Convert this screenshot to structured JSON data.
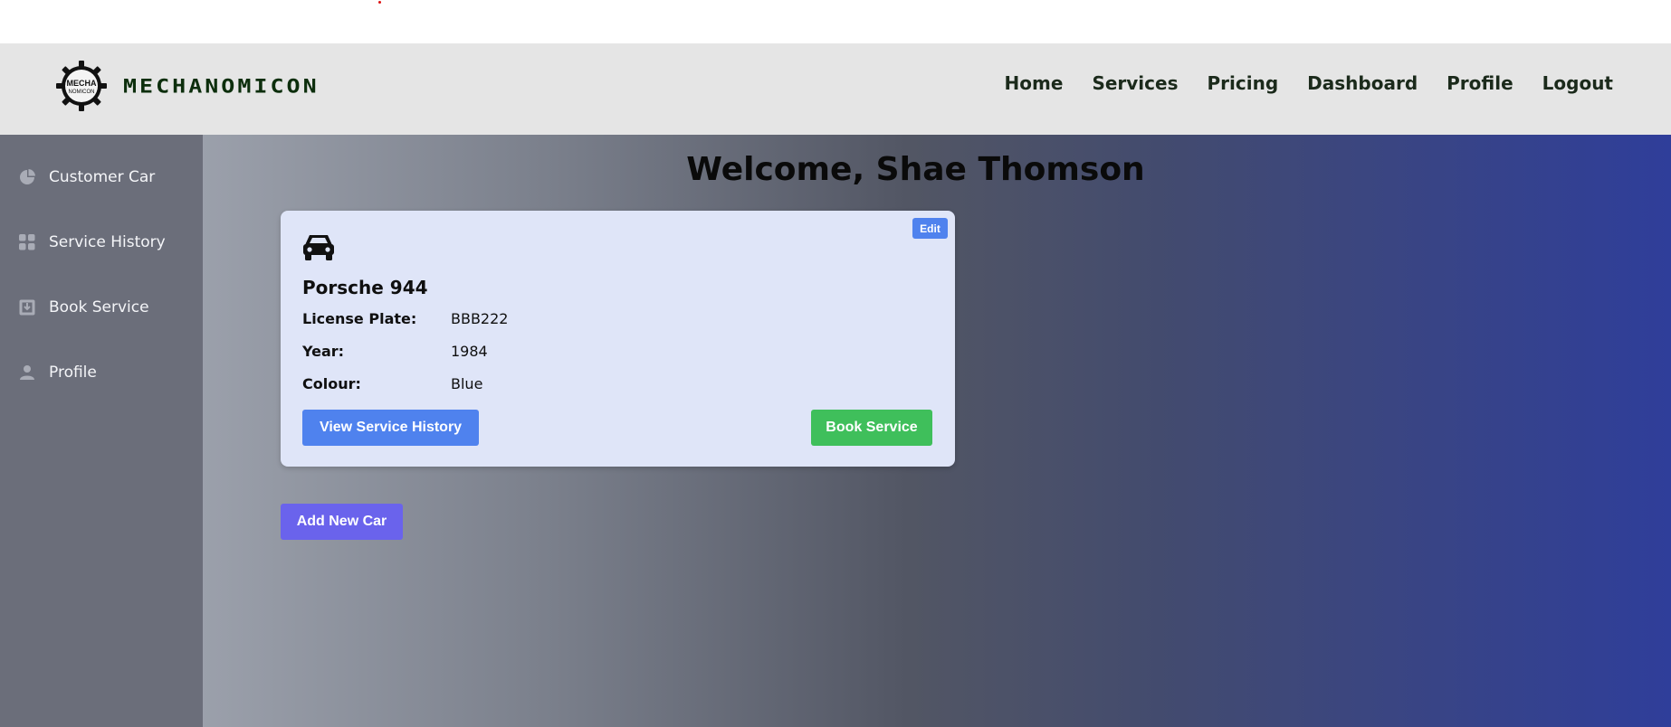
{
  "header": {
    "logo_badge_top": "MECHA",
    "logo_badge_bottom": "NOMICON",
    "logo_word": "MECHANOMICON",
    "nav": [
      "Home",
      "Services",
      "Pricing",
      "Dashboard",
      "Profile",
      "Logout"
    ]
  },
  "sidebar": {
    "items": [
      {
        "label": "Customer Car",
        "icon": "pie-chart-icon"
      },
      {
        "label": "Service History",
        "icon": "grid-icon"
      },
      {
        "label": "Book Service",
        "icon": "download-box-icon"
      },
      {
        "label": "Profile",
        "icon": "user-icon"
      }
    ]
  },
  "main": {
    "welcome": "Welcome, Shae Thomson",
    "card": {
      "edit_label": "Edit",
      "car_name": "Porsche 944",
      "fields": [
        {
          "key": "License Plate:",
          "value": "BBB222"
        },
        {
          "key": "Year:",
          "value": "1984"
        },
        {
          "key": "Colour:",
          "value": "Blue"
        }
      ],
      "history_button": "View Service History",
      "book_button": "Book Service"
    },
    "add_button": "Add New Car"
  },
  "colors": {
    "header_bg": "#e5e5e5",
    "sidebar_bg": "#6b6e7a",
    "card_bg": "#dfe5f8",
    "primary_blue": "#4f82ee",
    "success_green": "#3fbf5b",
    "purple": "#6a63ec"
  }
}
